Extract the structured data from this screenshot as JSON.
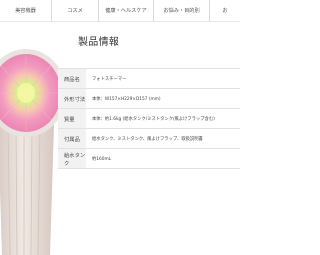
{
  "nav": {
    "items": [
      {
        "label": "美容機器"
      },
      {
        "label": "コスメ"
      },
      {
        "label": "健康・ヘルスケア"
      },
      {
        "label": "お悩み・目的別"
      },
      {
        "label": "お"
      }
    ]
  },
  "page": {
    "title": "製品情報"
  },
  "spec": {
    "rows": [
      {
        "label": "商品名",
        "value": "フォトスチーマー"
      },
      {
        "label": "外形寸法",
        "value": "本体：W157×H229×D157 (mm)"
      },
      {
        "label": "質量",
        "value": "本体：約1.6kg (給水タンク/ミストタンク/風よけフラップ含む)"
      },
      {
        "label": "付属品",
        "value": "給水タンク、ミストタンク、風よけフラップ、取扱説明書"
      },
      {
        "label": "給水タンク",
        "value": "約160mL"
      }
    ]
  },
  "colors": {
    "table_label_bg": "#f2f2f2",
    "border": "#e2e2e2",
    "product_body": "#e7dcd6",
    "light_ring_pink": "#f0a0c4",
    "light_center_green": "#e8f28a"
  }
}
